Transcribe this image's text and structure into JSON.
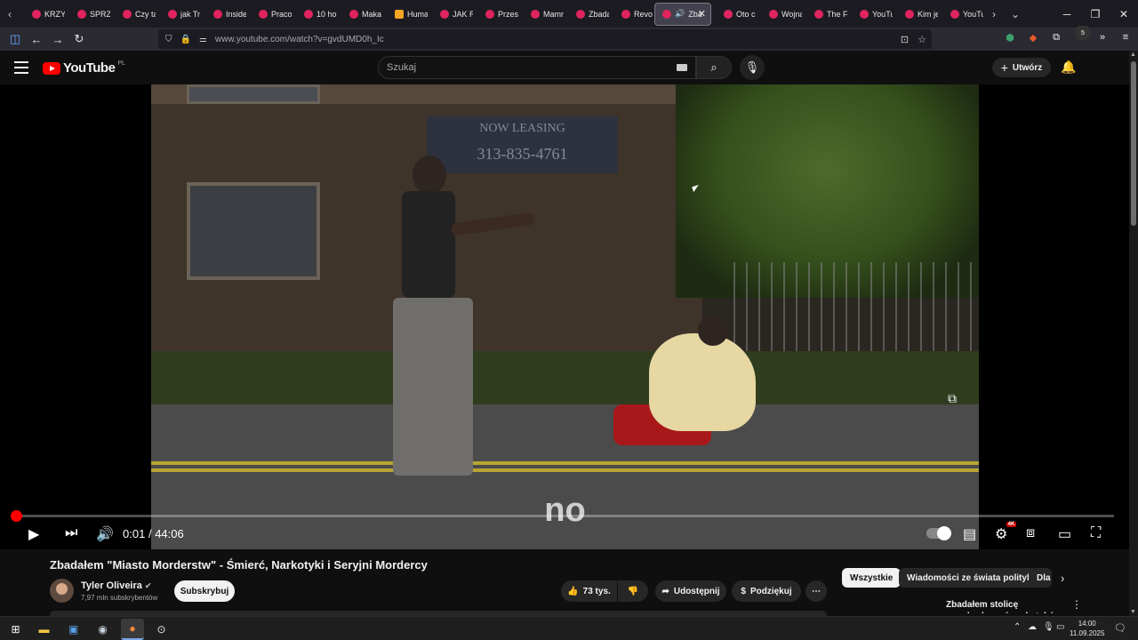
{
  "browser": {
    "tabs": [
      {
        "label": "KRZYŻ"
      },
      {
        "label": "SPRZĄ"
      },
      {
        "label": "Czy ta"
      },
      {
        "label": "jak Tr"
      },
      {
        "label": "Inside"
      },
      {
        "label": "Praco"
      },
      {
        "label": "10 ho"
      },
      {
        "label": "Maka"
      },
      {
        "label": "Huma"
      },
      {
        "label": "JAK R"
      },
      {
        "label": "Przes"
      },
      {
        "label": "Mamr"
      },
      {
        "label": "Zbada"
      },
      {
        "label": "Revo"
      },
      {
        "label": "Zba",
        "active": true
      },
      {
        "label": "Oto c"
      },
      {
        "label": "Wojna"
      },
      {
        "label": "The F"
      },
      {
        "label": "YouTu"
      },
      {
        "label": "Kim je"
      },
      {
        "label": "YouTu"
      }
    ],
    "url": "www.youtube.com/watch?v=gvdUMD0h_Ic",
    "extension_badge": "5"
  },
  "youtube": {
    "logo_text": "YouTube",
    "country_code": "PL",
    "search_placeholder": "Szukaj",
    "create_label": "Utwórz"
  },
  "player": {
    "caption_text": "no",
    "current_time": "0:01",
    "duration": "44:06",
    "time_separator": "/",
    "quality_badge": "4K",
    "progress_fraction": 0.0004
  },
  "video": {
    "title": "Zbadałem \"Miasto Morderstw\" - Śmierć, Narkotyki i Seryjni Mordercy",
    "channel_name": "Tyler Oliveira",
    "subscribers": "7,97 mln subskrybentów",
    "subscribe_label": "Subskrybuj",
    "like_count": "73 tys.",
    "share_label": "Udostępnij",
    "thanks_label": "Podziękuj"
  },
  "chips": [
    {
      "label": "Wszystkie",
      "selected": true
    },
    {
      "label": "Wiadomości ze świata polityki"
    },
    {
      "label": "Dla"
    }
  ],
  "recommendation": {
    "title": "Zbadałem stolicę przedawkowań narkotyków w"
  },
  "sign_text": {
    "line1": "NOW LEASING",
    "line2": "313-835-4761"
  },
  "taskbar": {
    "time": "14:00",
    "date": "11.09.2025"
  }
}
